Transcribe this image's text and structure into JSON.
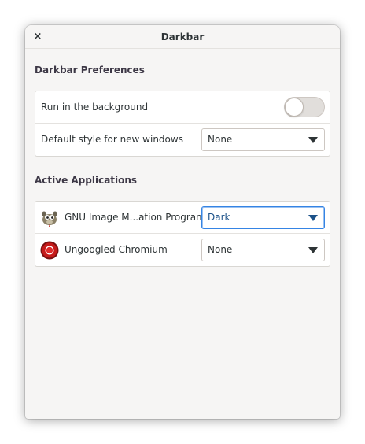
{
  "window": {
    "title": "Darkbar",
    "close_glyph": "×"
  },
  "preferences": {
    "heading": "Darkbar Preferences",
    "run_background": {
      "label": "Run in the background",
      "enabled": false
    },
    "default_style": {
      "label": "Default style for new windows",
      "value": "None"
    }
  },
  "active_apps": {
    "heading": "Active Applications",
    "items": [
      {
        "name": "GNU Image M...ation Program",
        "icon": "gimp-icon",
        "style": "Dark"
      },
      {
        "name": "Ungoogled Chromium",
        "icon": "chromium-icon",
        "style": "None"
      }
    ]
  },
  "colors": {
    "accent": "#3584e4",
    "window_bg": "#f6f5f4",
    "list_bg": "#ffffff"
  }
}
